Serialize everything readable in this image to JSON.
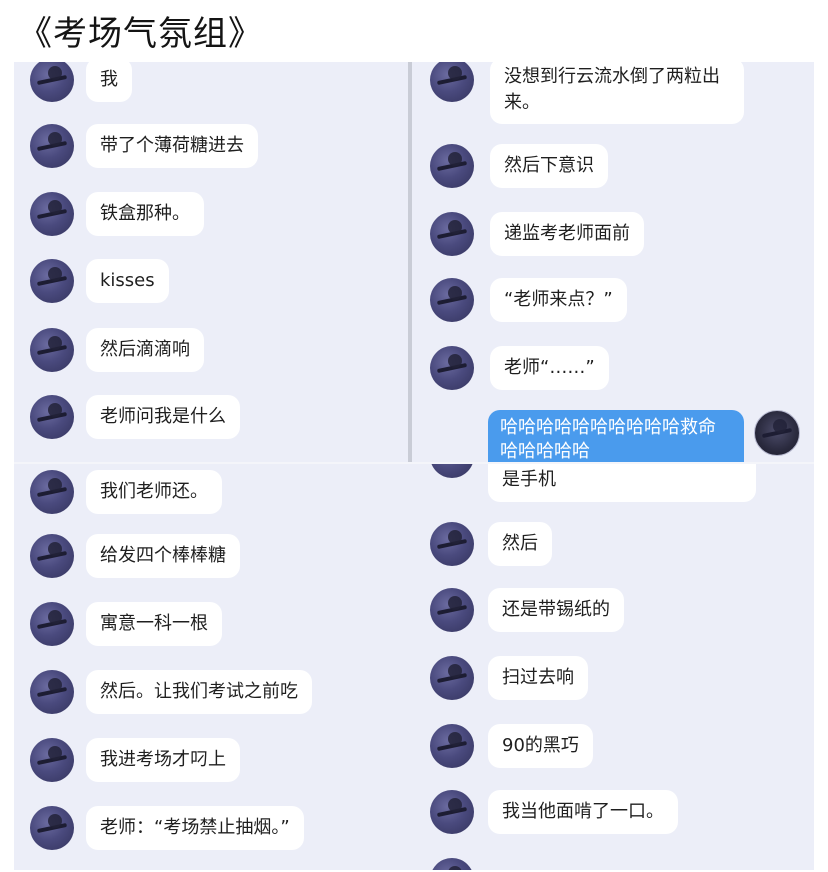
{
  "title": "《考场气氛组》",
  "panels": {
    "top_left": {
      "messages": [
        "我",
        "带了个薄荷糖进去",
        "铁盒那种。",
        "kisses",
        "然后滴滴响",
        "老师问我是什么"
      ]
    },
    "top_right": {
      "messages": [
        "没想到行云流水倒了两粒出来。",
        "然后下意识",
        "递监考老师面前",
        "“老师来点？”",
        "老师“……”"
      ],
      "self_message": "哈哈哈哈哈哈哈哈哈哈救命哈哈哈哈哈"
    },
    "bottom_left": {
      "messages": [
        "我们老师还。",
        "给发四个棒棒糖",
        "寓意一科一根",
        "然后。让我们考试之前吃",
        "我进考场才叼上",
        "老师：“考场禁止抽烟。”"
      ]
    },
    "bottom_right": {
      "messages": [
        "是手机",
        "然后",
        "还是带锡纸的",
        "扫过去响",
        "90的黑巧",
        "我当他面啃了一口。"
      ]
    }
  },
  "colors": {
    "panel_bg": "#eceef8",
    "bubble_bg": "#ffffff",
    "self_bubble_bg": "#4a9bed",
    "avatar": "#4a4a7e"
  }
}
